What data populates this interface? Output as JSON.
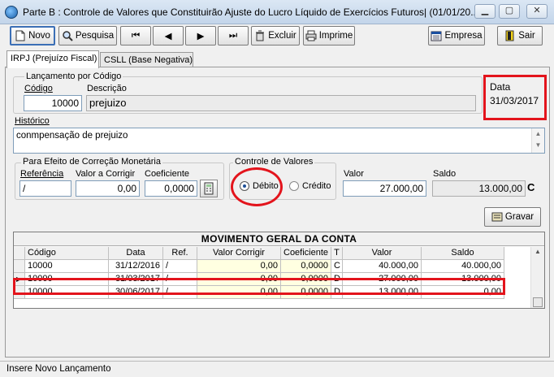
{
  "window": {
    "title": "Parte B : Controle de Valores que Constituirão Ajuste do Lucro Líquido de Exercícios Futuros| (01/01/20..."
  },
  "toolbar": {
    "novo": "Novo",
    "pesquisa": "Pesquisa",
    "excluir": "Excluir",
    "imprime": "Imprime",
    "empresa": "Empresa",
    "sair": "Sair"
  },
  "tabs": [
    "IRPJ (Prejuízo Fiscal)",
    "CSLL (Base Negativa)"
  ],
  "lancamento": {
    "group_label": "Lançamento por Código",
    "codigo_label": "Código",
    "codigo": "10000",
    "descricao_label": "Descrição",
    "descricao": "prejuizo",
    "data_label": "Data",
    "data": "31/03/2017"
  },
  "historico": {
    "label": "Histórico",
    "value": "conmpensação de prejuizo"
  },
  "correcao": {
    "group_label": "Para Efeito de Correção Monetária",
    "referencia_label": "Referência",
    "referencia": "/",
    "valor_label": "Valor a Corrigir",
    "valor": "0,00",
    "coef_label": "Coeficiente",
    "coef": "0,0000"
  },
  "controle": {
    "group_label": "Controle de Valores",
    "debito": "Débito",
    "credito": "Crédito",
    "selected": "Débito"
  },
  "valor": {
    "label": "Valor",
    "value": "27.000,00"
  },
  "saldo": {
    "label": "Saldo",
    "value": "13.000,00",
    "type": "C"
  },
  "gravar": "Gravar",
  "grid": {
    "title": "MOVIMENTO GERAL DA CONTA",
    "headers": [
      "Código",
      "Data",
      "Ref.",
      "Valor Corrigir",
      "Coeficiente",
      "T",
      "Valor",
      "Saldo"
    ],
    "rows": [
      [
        "10000",
        "31/12/2016",
        "/",
        "0,00",
        "0,0000",
        "C",
        "40.000,00",
        "40.000,00"
      ],
      [
        "10000",
        "31/03/2017",
        "/",
        "0,00",
        "0,0000",
        "D",
        "27.000,00",
        "13.000,00"
      ],
      [
        "10000",
        "30/06/2017",
        "/",
        "0,00",
        "0,0000",
        "D",
        "13.000,00",
        "0,00"
      ]
    ],
    "selected_row": 1
  },
  "status": "Insere Novo Lançamento",
  "colors": {
    "highlight": "#e3141c",
    "field_bg": "#ffffe1",
    "title_bg": "#c3d5ea"
  }
}
